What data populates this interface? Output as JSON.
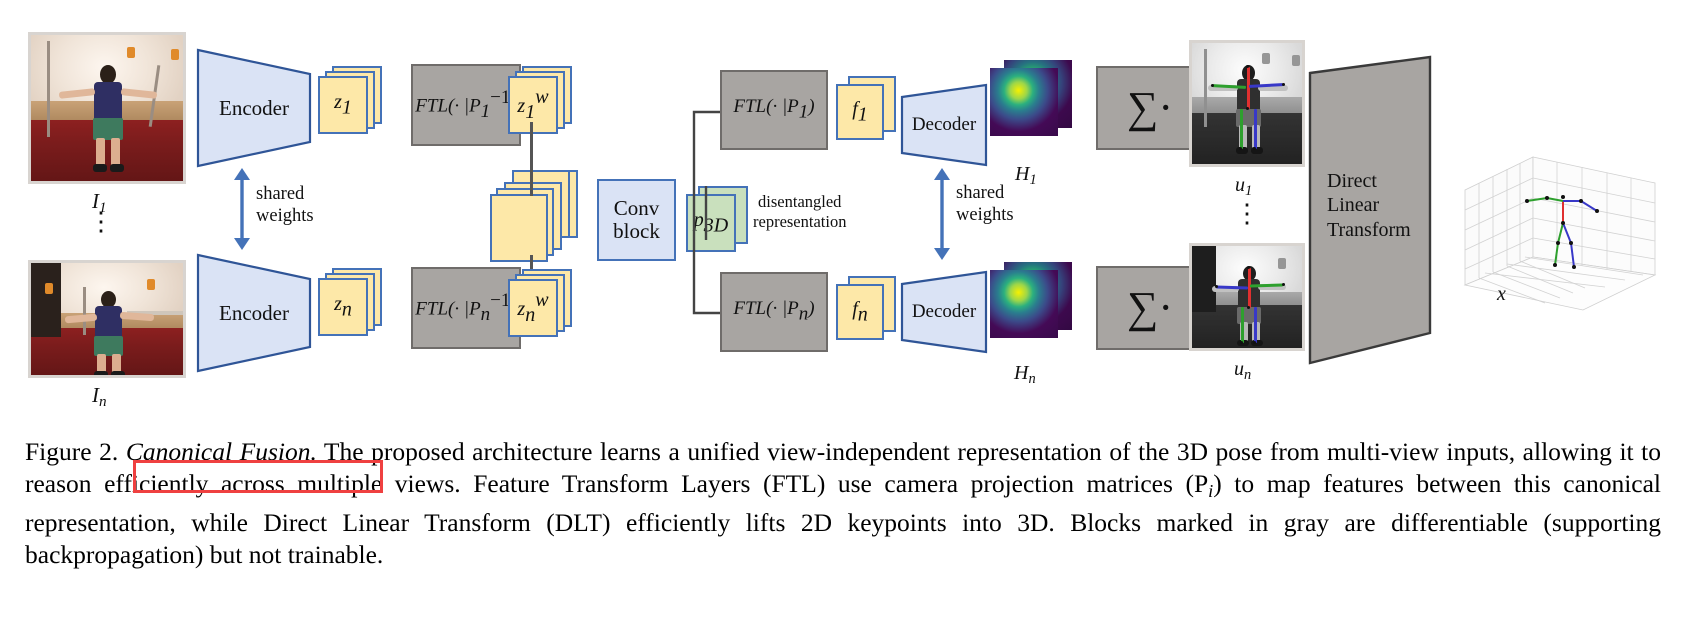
{
  "figure": {
    "inputs": [
      {
        "label_main": "I",
        "label_sub": "1",
        "name": "input-image-1"
      },
      {
        "label_main": "I",
        "label_sub": "n",
        "name": "input-image-n"
      }
    ],
    "encoders": [
      {
        "label": "Encoder"
      },
      {
        "label": "Encoder"
      }
    ],
    "latents": [
      {
        "main": "z",
        "sub": "1",
        "sup": ""
      },
      {
        "main": "z",
        "sub": "n",
        "sup": ""
      }
    ],
    "ftl_inverse": [
      {
        "label": "FTL(· |P",
        "sup": "-1",
        "sub": "1",
        "full": "FTL(· |P₁⁻¹)"
      },
      {
        "label": "FTL(· |P",
        "sup": "-1",
        "sub": "n",
        "full": "FTL(· |Pₙ⁻¹)"
      }
    ],
    "canonical": [
      {
        "main": "z",
        "sub": "1",
        "sup": "w"
      },
      {
        "main": "z",
        "sub": "n",
        "sup": "w"
      }
    ],
    "conv_block": {
      "line1": "Conv",
      "line2": "block"
    },
    "p3d": {
      "main": "p",
      "sub": "3D"
    },
    "disentangled": {
      "line1": "disentangled",
      "line2": "representation"
    },
    "ftl_forward": [
      {
        "label": "FTL(· |P",
        "sub": "1",
        "full": "FTL(· |P₁)"
      },
      {
        "label": "FTL(· |P",
        "sub": "n",
        "full": "FTL(· |Pₙ)"
      }
    ],
    "features": [
      {
        "main": "f",
        "sub": "1"
      },
      {
        "main": "f",
        "sub": "n"
      }
    ],
    "decoders": [
      {
        "label": "Decoder"
      },
      {
        "label": "Decoder"
      }
    ],
    "heatmaps": [
      {
        "main": "H",
        "sub": "1"
      },
      {
        "main": "H",
        "sub": "n"
      }
    ],
    "sum_blocks": [
      {
        "label": "∑·"
      },
      {
        "label": "∑·"
      }
    ],
    "keypoint_images": [
      {
        "main": "u",
        "sub": "1"
      },
      {
        "main": "u",
        "sub": "n"
      }
    ],
    "dlt": {
      "line1": "Direct",
      "line2": "Linear",
      "line3": "Transform"
    },
    "output": {
      "main": "x"
    },
    "shared_weights": [
      {
        "line1": "shared",
        "line2": "weights"
      },
      {
        "line1": "shared",
        "line2": "weights"
      }
    ],
    "vertical_dots": "⋮",
    "colors": {
      "feature_fill": "#fde8a8",
      "feature_border": "#4472b8",
      "canonical_fill": "#c9e0bd",
      "gray_block_fill": "#a8a5a2",
      "gray_block_border": "#6f6c6a",
      "conv_block_fill": "#dae3f5",
      "arrow_blue": "#4472b8",
      "dlt_fill": "#a8a5a2",
      "highlight_red": "#ef4040"
    }
  },
  "caption": {
    "prefix": "Figure 2.",
    "title": "Canonical Fusion.",
    "body": " The proposed architecture learns a unified view-independent representation of the 3D pose from multi-view inputs, allowing it to reason efficiently across multiple views. Feature Transform Layers (FTL) use camera projection matrices (P",
    "body_sub": "i",
    "body2": ") to map features between this canonical representation, while Direct Linear Transform (DLT) efficiently lifts 2D keypoints into 3D. Blocks marked in gray are differentiable (supporting backpropagation) but not trainable."
  }
}
